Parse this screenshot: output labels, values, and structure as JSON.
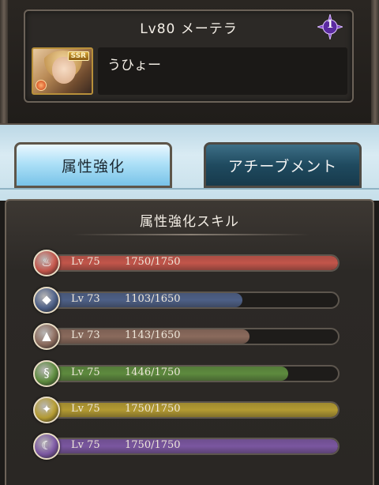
{
  "character": {
    "title": "Lv80 メーテラ",
    "rank": "1",
    "rarity": "SSR",
    "comment": "うひょー"
  },
  "tabs": [
    {
      "label": "属性強化",
      "active": true
    },
    {
      "label": "アチーブメント",
      "active": false
    }
  ],
  "skills_panel": {
    "title": "属性強化スキル",
    "skills": [
      {
        "element": "fire",
        "icon": "fire-icon",
        "level": "Lv 75",
        "exp": "1750/1750",
        "progress": 1.0,
        "color": "#c2554a"
      },
      {
        "element": "water",
        "icon": "water-icon",
        "level": "Lv 73",
        "exp": "1103/1650",
        "progress": 0.668,
        "color": "#4d5f86"
      },
      {
        "element": "earth",
        "icon": "earth-icon",
        "level": "Lv 73",
        "exp": "1143/1650",
        "progress": 0.693,
        "color": "#8a6a5c"
      },
      {
        "element": "wind",
        "icon": "wind-icon",
        "level": "Lv 75",
        "exp": "1446/1750",
        "progress": 0.826,
        "color": "#5d8a3e"
      },
      {
        "element": "light",
        "icon": "light-icon",
        "level": "Lv 75",
        "exp": "1750/1750",
        "progress": 1.0,
        "color": "#b39a32"
      },
      {
        "element": "dark",
        "icon": "dark-icon",
        "level": "Lv 75",
        "exp": "1750/1750",
        "progress": 1.0,
        "color": "#7a56a0"
      }
    ]
  }
}
